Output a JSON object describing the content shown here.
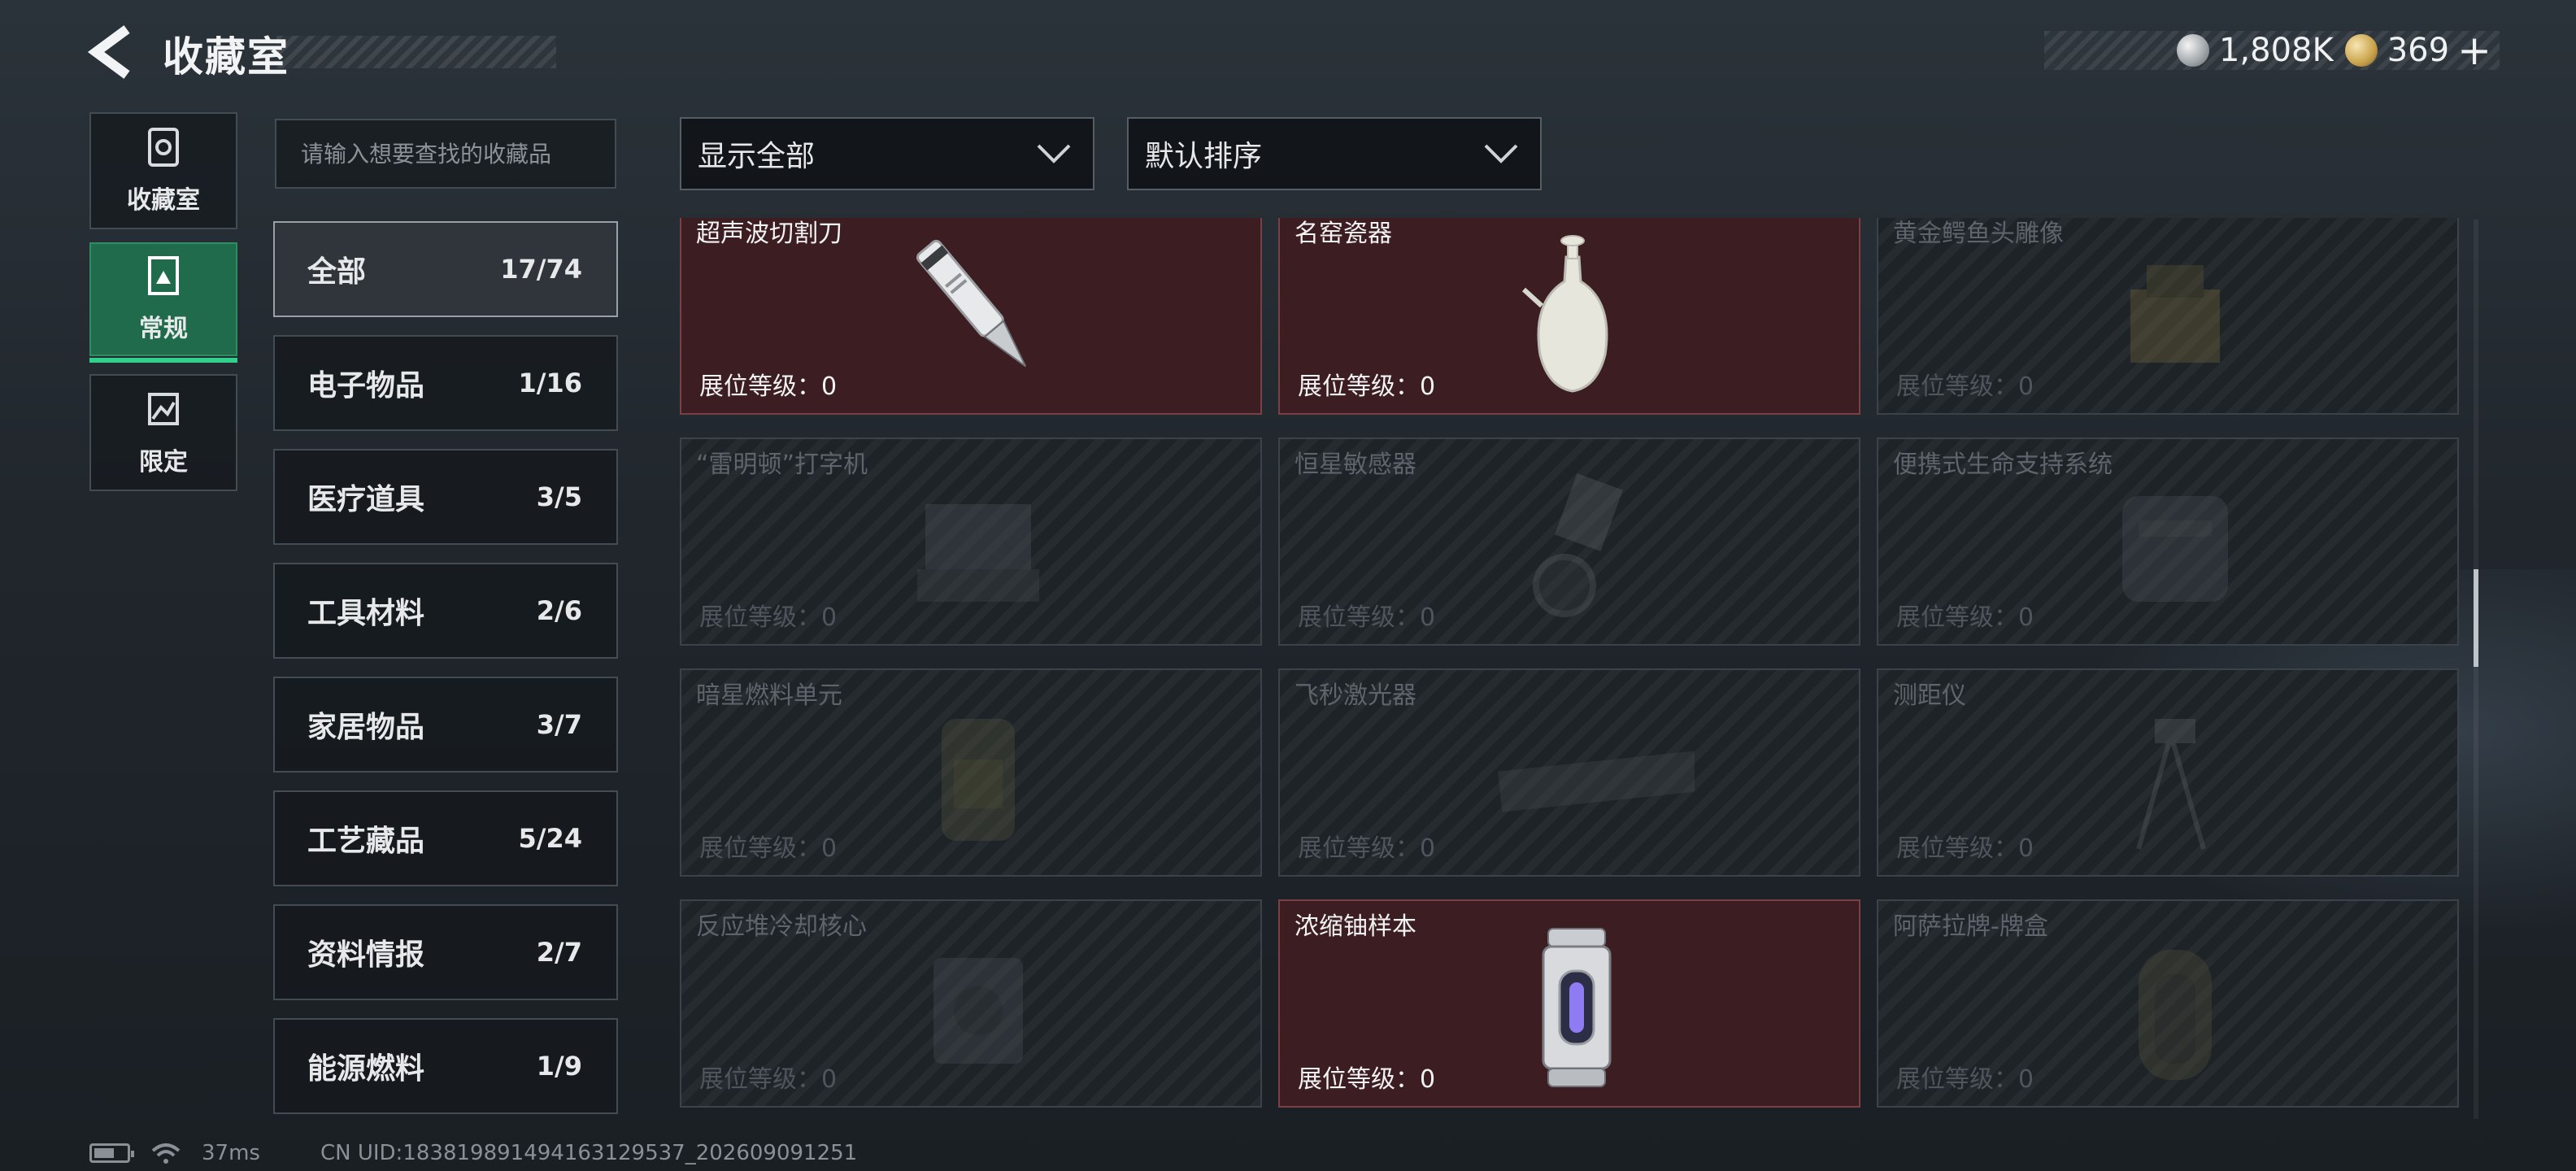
{
  "header": {
    "title": "收藏室",
    "back_icon": "back-arrow-icon",
    "currencies": [
      {
        "icon": "silver-coin-icon",
        "value": "1,808K"
      },
      {
        "icon": "gold-coin-icon",
        "value": "369"
      }
    ],
    "plus_label": "+"
  },
  "rail": {
    "items": [
      {
        "label": "收藏室",
        "icon": "collection-room-icon"
      },
      {
        "label": "常规",
        "icon": "regular-icon",
        "active": true
      },
      {
        "label": "限定",
        "icon": "limited-icon"
      }
    ]
  },
  "search": {
    "placeholder": "请输入想要查找的收藏品",
    "value": ""
  },
  "filters": {
    "display": {
      "value": "显示全部"
    },
    "sort": {
      "value": "默认排序"
    }
  },
  "categories": [
    {
      "name": "全部",
      "count": "17/74",
      "active": true
    },
    {
      "name": "电子物品",
      "count": "1/16"
    },
    {
      "name": "医疗道具",
      "count": "3/5"
    },
    {
      "name": "工具材料",
      "count": "2/6"
    },
    {
      "name": "家居物品",
      "count": "3/7"
    },
    {
      "name": "工艺藏品",
      "count": "5/24"
    },
    {
      "name": "资料情报",
      "count": "2/7"
    },
    {
      "name": "能源燃料",
      "count": "1/9"
    }
  ],
  "items": [
    {
      "name": "超声波切割刀",
      "level": "展位等级：0",
      "owned": true,
      "icon": "ultrasonic-knife-icon"
    },
    {
      "name": "名窑瓷器",
      "level": "展位等级：0",
      "owned": true,
      "icon": "porcelain-vase-icon"
    },
    {
      "name": "黄金鳄鱼头雕像",
      "level": "展位等级：0",
      "owned": false,
      "icon": "gold-croc-statue-icon"
    },
    {
      "name": "“雷明顿”打字机",
      "level": "展位等级：0",
      "owned": false,
      "icon": "typewriter-icon"
    },
    {
      "name": "恒星敏感器",
      "level": "展位等级：0",
      "owned": false,
      "icon": "star-sensor-icon"
    },
    {
      "name": "便携式生命支持系统",
      "level": "展位等级：0",
      "owned": false,
      "icon": "life-support-icon"
    },
    {
      "name": "暗星燃料单元",
      "level": "展位等级：0",
      "owned": false,
      "icon": "fuel-cell-icon"
    },
    {
      "name": "飞秒激光器",
      "level": "展位等级：0",
      "owned": false,
      "icon": "laser-icon"
    },
    {
      "name": "测距仪",
      "level": "展位等级：0",
      "owned": false,
      "icon": "rangefinder-icon"
    },
    {
      "name": "反应堆冷却核心",
      "level": "展位等级：0",
      "owned": false,
      "icon": "reactor-core-icon"
    },
    {
      "name": "浓缩铀样本",
      "level": "展位等级：0",
      "owned": true,
      "icon": "uranium-sample-icon"
    },
    {
      "name": "阿萨拉牌-牌盒",
      "level": "展位等级：0",
      "owned": false,
      "icon": "card-box-icon"
    }
  ],
  "footer": {
    "latency": "37ms",
    "uid": "CN UID:183819891494163129537_202609091251"
  }
}
